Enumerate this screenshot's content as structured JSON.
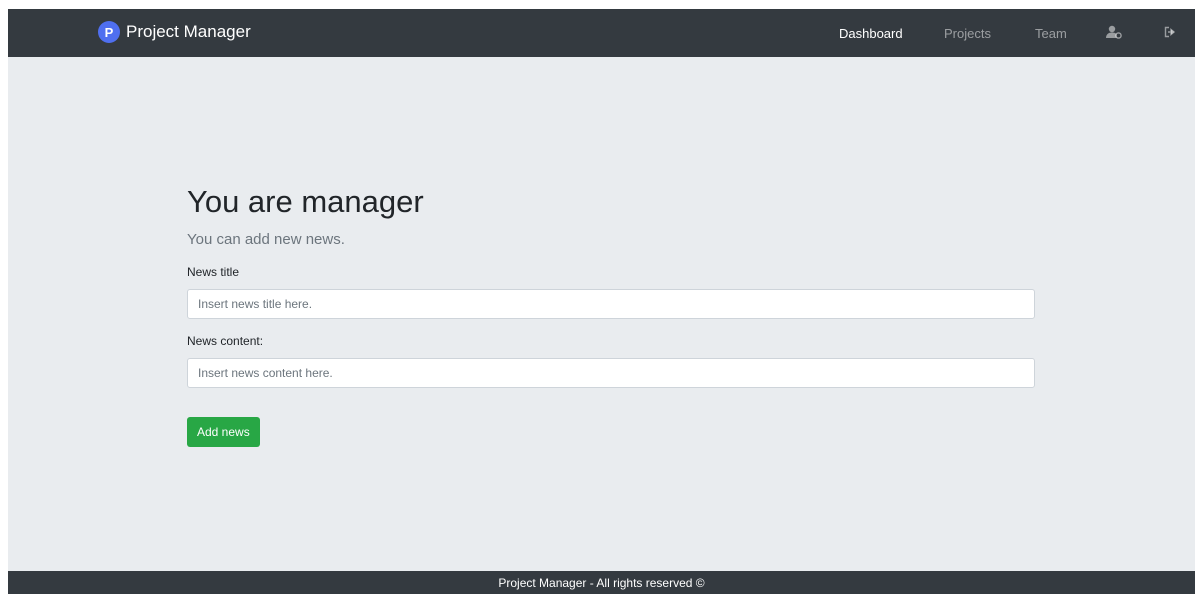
{
  "brand": {
    "name": "Project Manager",
    "logo_text": "P",
    "logo_icon": "project-manager-logo-icon"
  },
  "nav": {
    "items": [
      {
        "label": "Dashboard",
        "active": true
      },
      {
        "label": "Projects",
        "active": false
      },
      {
        "label": "Team",
        "active": false
      }
    ],
    "profile_icon": "user-settings-icon",
    "logout_icon": "logout-icon"
  },
  "main": {
    "title": "You are manager",
    "subtitle": "You can add new news.",
    "news_title_label": "News title",
    "news_title_placeholder": "Insert news title here.",
    "news_content_label": "News content:",
    "news_content_placeholder": "Insert news content here.",
    "add_button_label": "Add news"
  },
  "footer": {
    "text": "Project Manager - All rights reserved ©"
  },
  "colors": {
    "navbar": "#343a40",
    "page_background": "#e9ecef",
    "success_button": "#28a745",
    "logo_accent": "#4f6ff0"
  }
}
